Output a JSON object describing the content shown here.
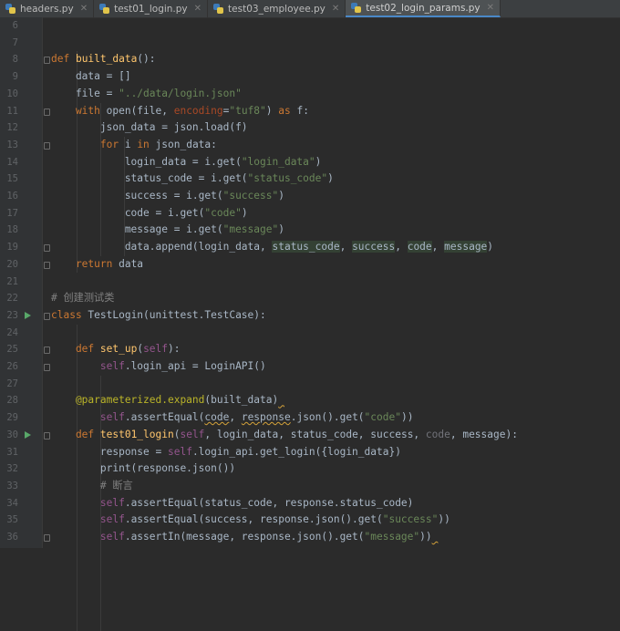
{
  "tabs": [
    {
      "label": "headers.py",
      "active": false
    },
    {
      "label": "test01_login.py",
      "active": false
    },
    {
      "label": "test03_employee.py",
      "active": false
    },
    {
      "label": "test02_login_params.py",
      "active": true
    }
  ],
  "colors": {
    "background": "#2b2b2b",
    "keyword": "#cc7832",
    "string": "#6a8759",
    "function": "#ffc66d",
    "self": "#94558d",
    "decorator": "#bbb529",
    "comment": "#808080",
    "run_icon": "#59a869"
  },
  "lines": [
    {
      "n": "6",
      "tokens": []
    },
    {
      "n": "7",
      "tokens": []
    },
    {
      "n": "8",
      "fold": true,
      "tokens": [
        [
          "kw",
          "def "
        ],
        [
          "fn",
          "built_data"
        ],
        [
          "",
          "():"
        ]
      ]
    },
    {
      "n": "9",
      "tokens": [
        [
          "",
          "    data = []"
        ]
      ]
    },
    {
      "n": "10",
      "tokens": [
        [
          "",
          "    file = "
        ],
        [
          "str",
          "\"../data/login.json\""
        ]
      ]
    },
    {
      "n": "11",
      "fold": true,
      "tokens": [
        [
          "kw",
          "    with "
        ],
        [
          "",
          "open(file, "
        ],
        [
          "param",
          "encoding"
        ],
        [
          "",
          "="
        ],
        [
          "str",
          "\"tuf8\""
        ],
        [
          "",
          ") "
        ],
        [
          "kw",
          "as "
        ],
        [
          "",
          "f:"
        ]
      ]
    },
    {
      "n": "12",
      "tokens": [
        [
          "",
          "        json_data = json.load(f)"
        ]
      ]
    },
    {
      "n": "13",
      "fold": true,
      "tokens": [
        [
          "kw",
          "        for "
        ],
        [
          "",
          "i "
        ],
        [
          "kw",
          "in "
        ],
        [
          "",
          "json_data:"
        ]
      ]
    },
    {
      "n": "14",
      "tokens": [
        [
          "",
          "            login_data = i.get("
        ],
        [
          "str",
          "\"login_data\""
        ],
        [
          "",
          ")"
        ]
      ]
    },
    {
      "n": "15",
      "tokens": [
        [
          "",
          "            status_code = i.get("
        ],
        [
          "str",
          "\"status_code\""
        ],
        [
          "",
          ")"
        ]
      ]
    },
    {
      "n": "16",
      "tokens": [
        [
          "",
          "            success = i.get("
        ],
        [
          "str",
          "\"success\""
        ],
        [
          "",
          ")"
        ]
      ]
    },
    {
      "n": "17",
      "tokens": [
        [
          "",
          "            code = i.get("
        ],
        [
          "str",
          "\"code\""
        ],
        [
          "",
          ")"
        ]
      ]
    },
    {
      "n": "18",
      "tokens": [
        [
          "",
          "            message = i.get("
        ],
        [
          "str",
          "\"message\""
        ],
        [
          "",
          ")"
        ]
      ]
    },
    {
      "n": "19",
      "fold": true,
      "tokens": [
        [
          "",
          "            data.append(login_data, "
        ],
        [
          "hl",
          "status_code"
        ],
        [
          "",
          ", "
        ],
        [
          "hl",
          "success"
        ],
        [
          "",
          ", "
        ],
        [
          "hl",
          "code"
        ],
        [
          "",
          ", "
        ],
        [
          "hl",
          "message"
        ],
        [
          "",
          ")"
        ]
      ]
    },
    {
      "n": "20",
      "fold": true,
      "tokens": [
        [
          "kw",
          "    return "
        ],
        [
          "",
          "data"
        ]
      ]
    },
    {
      "n": "21",
      "tokens": []
    },
    {
      "n": "22",
      "tokens": [
        [
          "cmt",
          "# 创建测试类"
        ]
      ]
    },
    {
      "n": "23",
      "run": true,
      "fold": true,
      "tokens": [
        [
          "kw",
          "class "
        ],
        [
          "",
          "TestLogin(unittest.TestCase):"
        ]
      ]
    },
    {
      "n": "24",
      "tokens": []
    },
    {
      "n": "25",
      "fold": true,
      "tokens": [
        [
          "kw",
          "    def "
        ],
        [
          "fn",
          "set_up"
        ],
        [
          "",
          "("
        ],
        [
          "self",
          "self"
        ],
        [
          "",
          "):"
        ]
      ]
    },
    {
      "n": "26",
      "fold": true,
      "tokens": [
        [
          "self",
          "        self"
        ],
        [
          "",
          ".login_api = LoginAPI()"
        ]
      ]
    },
    {
      "n": "27",
      "tokens": []
    },
    {
      "n": "28",
      "tokens": [
        [
          "deco",
          "    @parameterized.expand"
        ],
        [
          "",
          "(built_data)"
        ],
        [
          "under",
          " "
        ]
      ]
    },
    {
      "n": "29",
      "tokens": [
        [
          "self",
          "        self"
        ],
        [
          "",
          ".assertEqual("
        ],
        [
          "under",
          "code"
        ],
        [
          "",
          ", "
        ],
        [
          "under",
          "response"
        ],
        [
          "",
          ".json().get("
        ],
        [
          "str",
          "\"code\""
        ],
        [
          "",
          "))"
        ]
      ]
    },
    {
      "n": "30",
      "run": true,
      "fold": true,
      "tokens": [
        [
          "kw",
          "    def "
        ],
        [
          "fn",
          "test01_login"
        ],
        [
          "",
          "("
        ],
        [
          "self",
          "self"
        ],
        [
          "",
          ", login_data, status_code, success, "
        ],
        [
          "dim",
          "code"
        ],
        [
          "",
          ", message):"
        ]
      ]
    },
    {
      "n": "31",
      "tokens": [
        [
          "",
          "        response = "
        ],
        [
          "self",
          "self"
        ],
        [
          "",
          ".login_api.get_login({login_data})"
        ]
      ]
    },
    {
      "n": "32",
      "tokens": [
        [
          "",
          "        print(response.json())"
        ]
      ]
    },
    {
      "n": "33",
      "tokens": [
        [
          "cmt",
          "        # 断言"
        ]
      ]
    },
    {
      "n": "34",
      "tokens": [
        [
          "self",
          "        self"
        ],
        [
          "",
          ".assertEqual(status_code, response.status_code)"
        ]
      ]
    },
    {
      "n": "35",
      "tokens": [
        [
          "self",
          "        self"
        ],
        [
          "",
          ".assertEqual(success, response.json().get("
        ],
        [
          "str",
          "\"success\""
        ],
        [
          "",
          "))"
        ]
      ]
    },
    {
      "n": "36",
      "fold": true,
      "tokens": [
        [
          "self",
          "        self"
        ],
        [
          "",
          ".assertIn(message, response.json().get("
        ],
        [
          "str",
          "\"message\""
        ],
        [
          "",
          "))"
        ],
        [
          "under",
          " "
        ]
      ]
    }
  ]
}
